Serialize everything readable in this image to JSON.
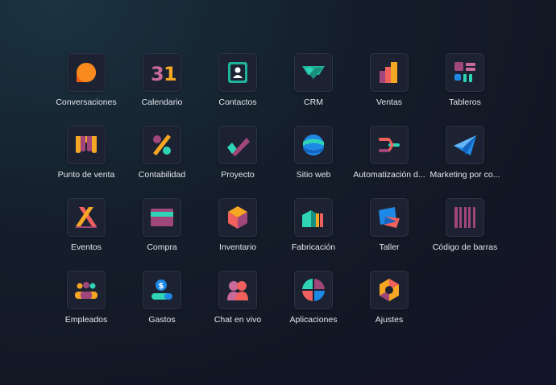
{
  "apps": [
    {
      "label": "Conversaciones",
      "icon": "chat-bubble-icon"
    },
    {
      "label": "Calendario",
      "icon": "calendar-icon",
      "glyph": "31"
    },
    {
      "label": "Contactos",
      "icon": "contact-card-icon"
    },
    {
      "label": "CRM",
      "icon": "handshake-icon"
    },
    {
      "label": "Ventas",
      "icon": "bar-chart-icon"
    },
    {
      "label": "Tableros",
      "icon": "dashboard-icon"
    },
    {
      "label": "Punto de venta",
      "icon": "shop-awning-icon"
    },
    {
      "label": "Contabilidad",
      "icon": "percent-icon"
    },
    {
      "label": "Proyecto",
      "icon": "checkmark-icon"
    },
    {
      "label": "Sitio web",
      "icon": "globe-icon"
    },
    {
      "label": "Automatización d...",
      "icon": "automation-icon"
    },
    {
      "label": "Marketing por co...",
      "icon": "paper-plane-icon"
    },
    {
      "label": "Eventos",
      "icon": "ribbon-icon"
    },
    {
      "label": "Compra",
      "icon": "credit-card-icon"
    },
    {
      "label": "Inventario",
      "icon": "box-icon"
    },
    {
      "label": "Fabricación",
      "icon": "factory-icon"
    },
    {
      "label": "Taller",
      "icon": "tag-icon"
    },
    {
      "label": "Código de barras",
      "icon": "barcode-icon"
    },
    {
      "label": "Empleados",
      "icon": "people-icon"
    },
    {
      "label": "Gastos",
      "icon": "money-person-icon"
    },
    {
      "label": "Chat en vivo",
      "icon": "live-chat-icon"
    },
    {
      "label": "Aplicaciones",
      "icon": "apps-circle-icon"
    },
    {
      "label": "Ajustes",
      "icon": "settings-icon"
    }
  ]
}
